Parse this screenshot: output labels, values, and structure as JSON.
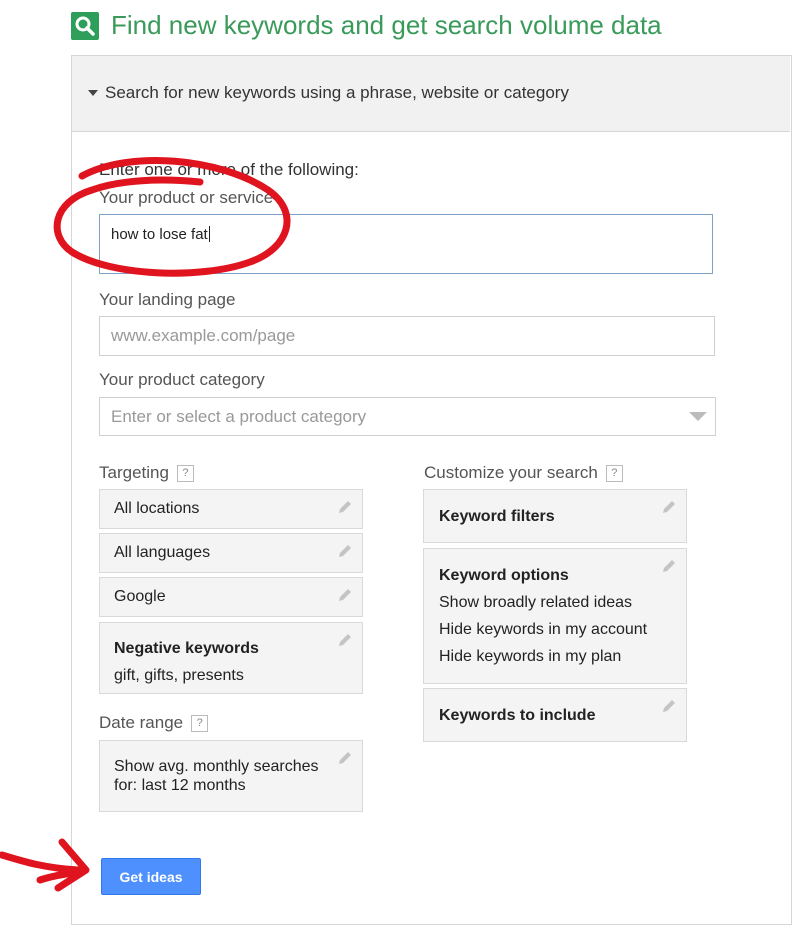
{
  "header": {
    "icon": "search-icon",
    "title": "Find new keywords and get search volume data",
    "accent_color": "#3a9a5a"
  },
  "section": {
    "label": "Search for new keywords using a phrase, website or category"
  },
  "form": {
    "intro": "Enter one or more of the following:",
    "product_label": "Your product or service",
    "product_value": "how to lose fat",
    "landing_label": "Your landing page",
    "landing_placeholder": "www.example.com/page",
    "category_label": "Your product category",
    "category_placeholder": "Enter or select a product category"
  },
  "targeting": {
    "label": "Targeting",
    "help": "?",
    "location": "All locations",
    "language": "All languages",
    "network": "Google",
    "negative_title": "Negative keywords",
    "negative_value": "gift, gifts, presents"
  },
  "date_range": {
    "label": "Date range",
    "help": "?",
    "line1": "Show avg. monthly searches",
    "line2": "for: last 12 months"
  },
  "customize": {
    "label": "Customize your search",
    "help": "?",
    "filters_title": "Keyword filters",
    "options_title": "Keyword options",
    "options": [
      "Show broadly related ideas",
      "Hide keywords in my account",
      "Hide keywords in my plan"
    ],
    "include_title": "Keywords to include"
  },
  "actions": {
    "get_ideas": "Get ideas",
    "button_color": "#4d90fe"
  },
  "annotations": {
    "color": "#e0141e"
  }
}
